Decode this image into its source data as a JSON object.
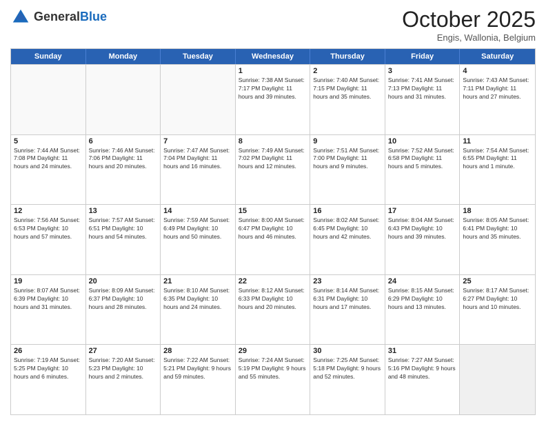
{
  "header": {
    "logo_general": "General",
    "logo_blue": "Blue",
    "month": "October 2025",
    "location": "Engis, Wallonia, Belgium"
  },
  "days_of_week": [
    "Sunday",
    "Monday",
    "Tuesday",
    "Wednesday",
    "Thursday",
    "Friday",
    "Saturday"
  ],
  "rows": [
    [
      {
        "day": "",
        "info": "",
        "empty": true
      },
      {
        "day": "",
        "info": "",
        "empty": true
      },
      {
        "day": "",
        "info": "",
        "empty": true
      },
      {
        "day": "1",
        "info": "Sunrise: 7:38 AM\nSunset: 7:17 PM\nDaylight: 11 hours\nand 39 minutes."
      },
      {
        "day": "2",
        "info": "Sunrise: 7:40 AM\nSunset: 7:15 PM\nDaylight: 11 hours\nand 35 minutes."
      },
      {
        "day": "3",
        "info": "Sunrise: 7:41 AM\nSunset: 7:13 PM\nDaylight: 11 hours\nand 31 minutes."
      },
      {
        "day": "4",
        "info": "Sunrise: 7:43 AM\nSunset: 7:11 PM\nDaylight: 11 hours\nand 27 minutes."
      }
    ],
    [
      {
        "day": "5",
        "info": "Sunrise: 7:44 AM\nSunset: 7:08 PM\nDaylight: 11 hours\nand 24 minutes."
      },
      {
        "day": "6",
        "info": "Sunrise: 7:46 AM\nSunset: 7:06 PM\nDaylight: 11 hours\nand 20 minutes."
      },
      {
        "day": "7",
        "info": "Sunrise: 7:47 AM\nSunset: 7:04 PM\nDaylight: 11 hours\nand 16 minutes."
      },
      {
        "day": "8",
        "info": "Sunrise: 7:49 AM\nSunset: 7:02 PM\nDaylight: 11 hours\nand 12 minutes."
      },
      {
        "day": "9",
        "info": "Sunrise: 7:51 AM\nSunset: 7:00 PM\nDaylight: 11 hours\nand 9 minutes."
      },
      {
        "day": "10",
        "info": "Sunrise: 7:52 AM\nSunset: 6:58 PM\nDaylight: 11 hours\nand 5 minutes."
      },
      {
        "day": "11",
        "info": "Sunrise: 7:54 AM\nSunset: 6:55 PM\nDaylight: 11 hours\nand 1 minute."
      }
    ],
    [
      {
        "day": "12",
        "info": "Sunrise: 7:56 AM\nSunset: 6:53 PM\nDaylight: 10 hours\nand 57 minutes."
      },
      {
        "day": "13",
        "info": "Sunrise: 7:57 AM\nSunset: 6:51 PM\nDaylight: 10 hours\nand 54 minutes."
      },
      {
        "day": "14",
        "info": "Sunrise: 7:59 AM\nSunset: 6:49 PM\nDaylight: 10 hours\nand 50 minutes."
      },
      {
        "day": "15",
        "info": "Sunrise: 8:00 AM\nSunset: 6:47 PM\nDaylight: 10 hours\nand 46 minutes."
      },
      {
        "day": "16",
        "info": "Sunrise: 8:02 AM\nSunset: 6:45 PM\nDaylight: 10 hours\nand 42 minutes."
      },
      {
        "day": "17",
        "info": "Sunrise: 8:04 AM\nSunset: 6:43 PM\nDaylight: 10 hours\nand 39 minutes."
      },
      {
        "day": "18",
        "info": "Sunrise: 8:05 AM\nSunset: 6:41 PM\nDaylight: 10 hours\nand 35 minutes."
      }
    ],
    [
      {
        "day": "19",
        "info": "Sunrise: 8:07 AM\nSunset: 6:39 PM\nDaylight: 10 hours\nand 31 minutes."
      },
      {
        "day": "20",
        "info": "Sunrise: 8:09 AM\nSunset: 6:37 PM\nDaylight: 10 hours\nand 28 minutes."
      },
      {
        "day": "21",
        "info": "Sunrise: 8:10 AM\nSunset: 6:35 PM\nDaylight: 10 hours\nand 24 minutes."
      },
      {
        "day": "22",
        "info": "Sunrise: 8:12 AM\nSunset: 6:33 PM\nDaylight: 10 hours\nand 20 minutes."
      },
      {
        "day": "23",
        "info": "Sunrise: 8:14 AM\nSunset: 6:31 PM\nDaylight: 10 hours\nand 17 minutes."
      },
      {
        "day": "24",
        "info": "Sunrise: 8:15 AM\nSunset: 6:29 PM\nDaylight: 10 hours\nand 13 minutes."
      },
      {
        "day": "25",
        "info": "Sunrise: 8:17 AM\nSunset: 6:27 PM\nDaylight: 10 hours\nand 10 minutes."
      }
    ],
    [
      {
        "day": "26",
        "info": "Sunrise: 7:19 AM\nSunset: 5:25 PM\nDaylight: 10 hours\nand 6 minutes."
      },
      {
        "day": "27",
        "info": "Sunrise: 7:20 AM\nSunset: 5:23 PM\nDaylight: 10 hours\nand 2 minutes."
      },
      {
        "day": "28",
        "info": "Sunrise: 7:22 AM\nSunset: 5:21 PM\nDaylight: 9 hours\nand 59 minutes."
      },
      {
        "day": "29",
        "info": "Sunrise: 7:24 AM\nSunset: 5:19 PM\nDaylight: 9 hours\nand 55 minutes."
      },
      {
        "day": "30",
        "info": "Sunrise: 7:25 AM\nSunset: 5:18 PM\nDaylight: 9 hours\nand 52 minutes."
      },
      {
        "day": "31",
        "info": "Sunrise: 7:27 AM\nSunset: 5:16 PM\nDaylight: 9 hours\nand 48 minutes."
      },
      {
        "day": "",
        "info": "",
        "empty": true,
        "shaded": true
      }
    ]
  ]
}
